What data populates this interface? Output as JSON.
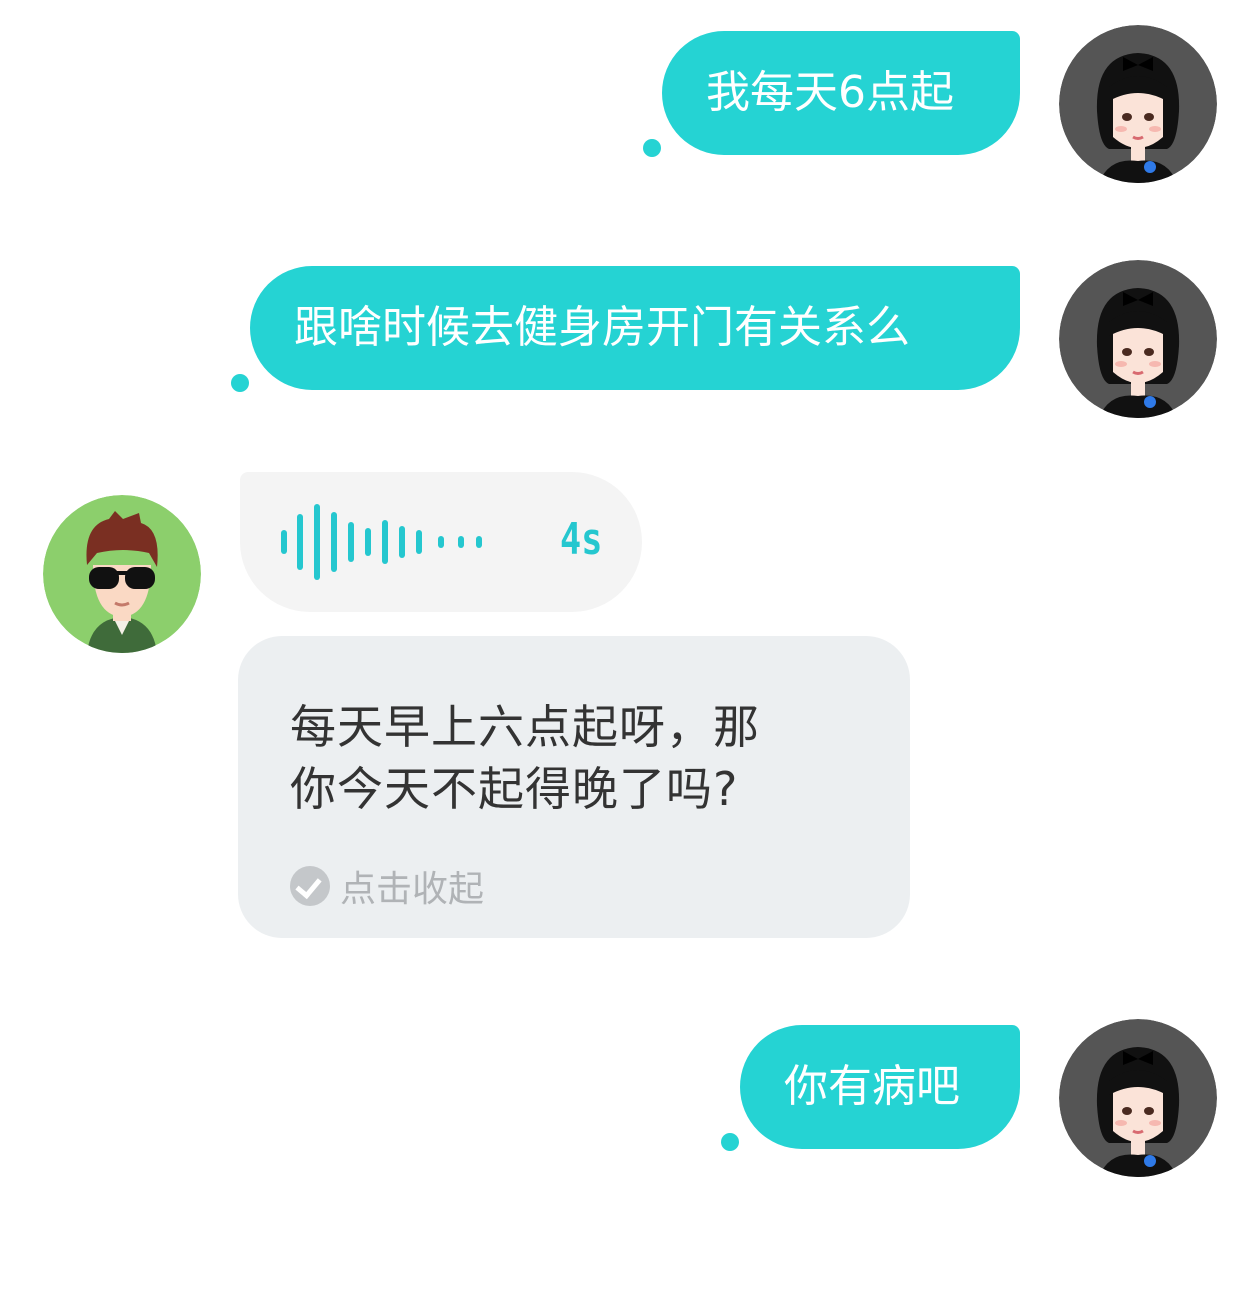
{
  "messages": [
    {
      "side": "right",
      "type": "text",
      "text": "我每天6点起"
    },
    {
      "side": "right",
      "type": "text",
      "text": "跟啥时候去健身房开门有关系么"
    },
    {
      "side": "left",
      "type": "voice",
      "duration": "4s",
      "transcript": {
        "line1": "每天早上六点起呀，那",
        "line2": "你今天不起得晚了吗?",
        "collapse_label": "点击收起"
      }
    },
    {
      "side": "right",
      "type": "text",
      "text": "你有病吧"
    }
  ],
  "colors": {
    "accent": "#25d3d3",
    "voice_bg": "#f4f4f4",
    "transcript_bg": "#eceff1",
    "male_avatar_bg": "#8ccf6c",
    "female_avatar_bg": "#555555"
  }
}
